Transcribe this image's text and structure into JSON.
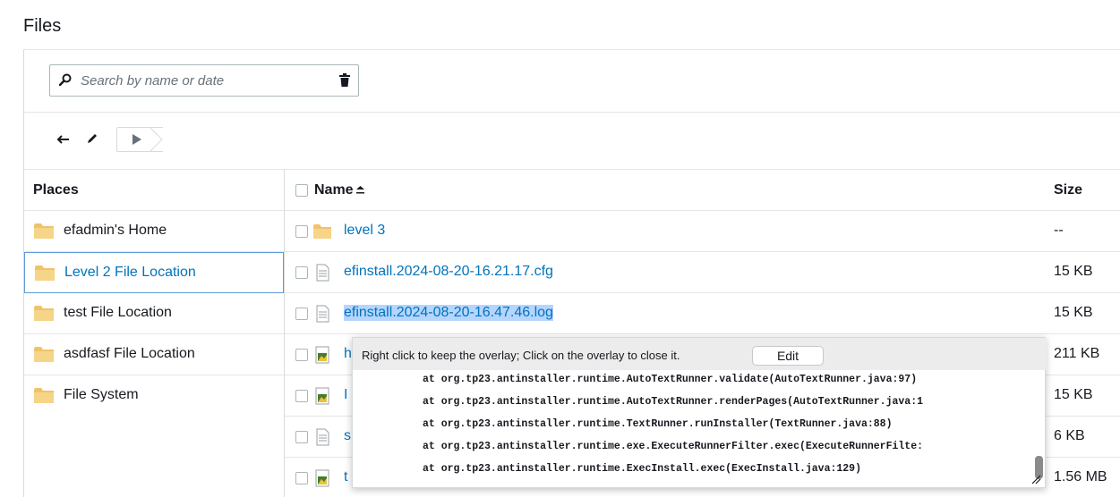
{
  "page": {
    "title": "Files"
  },
  "search": {
    "placeholder": "Search by name or date",
    "value": ""
  },
  "places": {
    "header": "Places",
    "items": [
      {
        "label": "efadmin's Home",
        "selected": false
      },
      {
        "label": "Level 2 File Location",
        "selected": true
      },
      {
        "label": "test File Location",
        "selected": false
      },
      {
        "label": "asdfasf File Location",
        "selected": false
      },
      {
        "label": "File System",
        "selected": false
      }
    ]
  },
  "files": {
    "columns": {
      "name": "Name",
      "size": "Size"
    },
    "rows": [
      {
        "name": "level 3",
        "size": "--",
        "type": "folder"
      },
      {
        "name": "efinstall.2024-08-20-16.21.17.cfg",
        "size": "15 KB",
        "type": "text"
      },
      {
        "name": "efinstall.2024-08-20-16.47.46.log",
        "size": "15 KB",
        "type": "text",
        "highlighted": true
      },
      {
        "name": "h",
        "size": "211 KB",
        "type": "image"
      },
      {
        "name": "I",
        "size": "15 KB",
        "type": "image"
      },
      {
        "name": "s",
        "size": "6 KB",
        "type": "text"
      },
      {
        "name": "t",
        "size": "1.56 MB",
        "type": "image"
      }
    ]
  },
  "overlay": {
    "message": "Right click to keep the overlay; Click on the overlay to close it.",
    "edit_label": "Edit",
    "lines": [
      "at org.tp23.antinstaller.runtime.AutoTextRunner.validate(AutoTextRunner.java:97)",
      "at org.tp23.antinstaller.runtime.AutoTextRunner.renderPages(AutoTextRunner.java:1",
      "at org.tp23.antinstaller.runtime.TextRunner.runInstaller(TextRunner.java:88)",
      "at org.tp23.antinstaller.runtime.exe.ExecuteRunnerFilter.exec(ExecuteRunnerFilte:",
      "at org.tp23.antinstaller.runtime.ExecInstall.exec(ExecInstall.java:129)"
    ]
  },
  "colors": {
    "link": "#0073bb",
    "selection": "#b4d5fe",
    "folder": "#f0c36a"
  }
}
